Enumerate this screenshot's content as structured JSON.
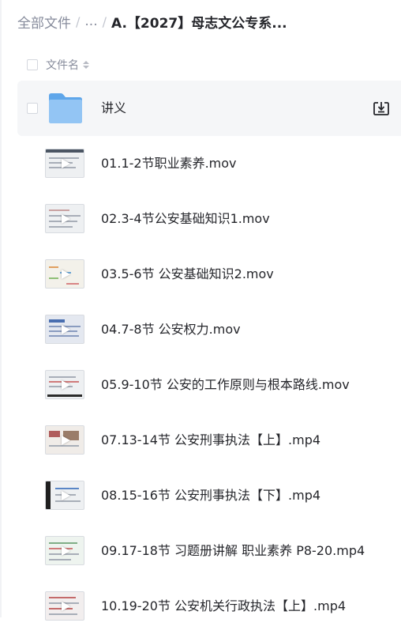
{
  "breadcrumb": {
    "root": "全部文件",
    "separator": "/",
    "ellipsis": "...",
    "current": "A.【2027】母志文公专系..."
  },
  "list_header": {
    "column_name": "文件名"
  },
  "folder": {
    "name": "讲义",
    "icon": "folder-icon",
    "action_icon": "download-icon"
  },
  "files": [
    {
      "name": "01.1-2节职业素养.mov"
    },
    {
      "name": "02.3-4节公安基础知识1.mov"
    },
    {
      "name": "03.5-6节 公安基础知识2.mov"
    },
    {
      "name": "04.7-8节 公安权力.mov"
    },
    {
      "name": "05.9-10节 公安的工作原则与根本路线.mov"
    },
    {
      "name": "07.13-14节 公安刑事执法【上】.mp4"
    },
    {
      "name": "08.15-16节 公安刑事执法【下】.mp4"
    },
    {
      "name": "09.17-18节 习题册讲解 职业素养 P8-20.mp4"
    },
    {
      "name": "10.19-20节 公安机关行政执法【上】.mp4"
    }
  ],
  "colors": {
    "text": "#25262b",
    "muted": "#878c9c",
    "hover_row": "#f5f6f8",
    "folder": "#7fb8f0"
  }
}
